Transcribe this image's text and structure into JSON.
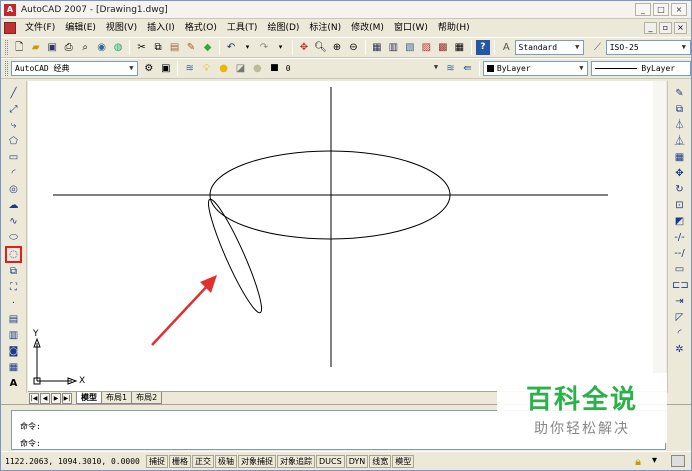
{
  "window": {
    "title": "AutoCAD 2007 - [Drawing1.dwg]",
    "logo_text": "A",
    "buttons": [
      "_",
      "□",
      "×"
    ]
  },
  "menu": {
    "items": [
      "文件(F)",
      "编辑(E)",
      "视图(V)",
      "插入(I)",
      "格式(O)",
      "工具(T)",
      "绘图(D)",
      "标注(N)",
      "修改(M)",
      "窗口(W)",
      "帮助(H)"
    ],
    "mdi_buttons": [
      "_",
      "▫",
      "×"
    ]
  },
  "toolbar1": {
    "text_style": "Standard",
    "dim_style": "ISO-25"
  },
  "toolbar2": {
    "workspace": "AutoCAD 经典",
    "layer": "0",
    "color": "ByLayer",
    "linetype": "ByLayer"
  },
  "ucs": {
    "x_label": "X",
    "y_label": "Y"
  },
  "layout_tabs": {
    "nav": [
      "|◀",
      "◀",
      "▶",
      "▶|"
    ],
    "tabs": [
      "模型",
      "布局1",
      "布局2"
    ],
    "active": "模型"
  },
  "command": {
    "line1": "命令:",
    "line2": "命令:"
  },
  "status": {
    "coords": "1122.2063, 1094.3010, 0.0000",
    "buttons": [
      "捕捉",
      "栅格",
      "正交",
      "极轴",
      "对象捕捉",
      "对象追踪",
      "DUCS",
      "DYN",
      "线宽",
      "模型"
    ]
  },
  "watermark": {
    "title": "百科全说",
    "subtitle": "助你轻松解决"
  },
  "colors": {
    "highlight_box": "#e02020",
    "arrow": "#e03030",
    "watermark_green": "#2bb14a"
  }
}
